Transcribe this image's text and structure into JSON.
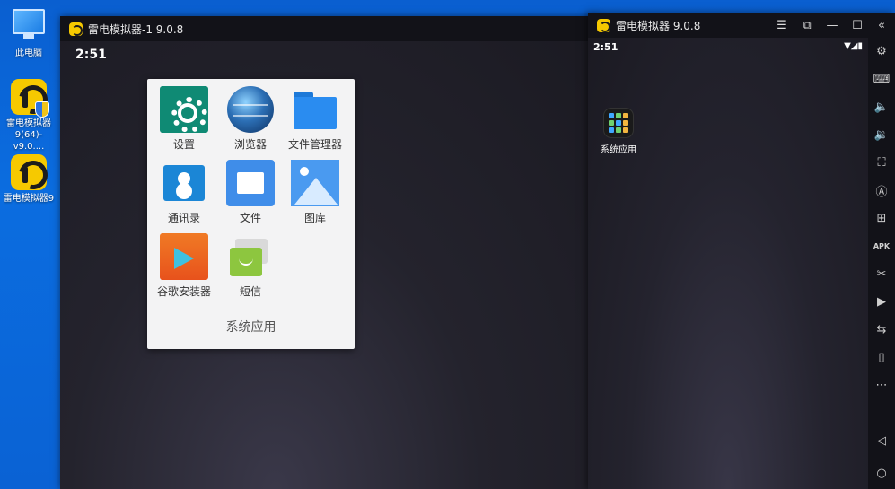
{
  "desktop": {
    "icons": [
      {
        "label": "此电脑"
      },
      {
        "label": "雷电模拟器9(64)-v9.0...."
      },
      {
        "label": "雷电模拟器9"
      }
    ]
  },
  "window1": {
    "title": "雷电模拟器-1 9.0.8",
    "clock": "2:51",
    "folder": {
      "title": "系统应用",
      "apps": [
        {
          "label": "设置",
          "icon": "settings-icon"
        },
        {
          "label": "浏览器",
          "icon": "browser-icon"
        },
        {
          "label": "文件管理器",
          "icon": "file-manager-icon"
        },
        {
          "label": "通讯录",
          "icon": "contacts-icon"
        },
        {
          "label": "文件",
          "icon": "files-icon"
        },
        {
          "label": "图库",
          "icon": "gallery-icon"
        },
        {
          "label": "谷歌安装器",
          "icon": "google-installer-icon"
        },
        {
          "label": "短信",
          "icon": "sms-icon"
        }
      ]
    }
  },
  "window2": {
    "title": "雷电模拟器 9.0.8",
    "clock": "2:51",
    "status_icons": "▼◢▮",
    "controls": {
      "menu": "☰",
      "restore": "⧉",
      "minimize": "—",
      "maximize": "☐",
      "close": "✕"
    },
    "home_app": {
      "label": "系统应用",
      "icon": "system-apps-folder-icon"
    },
    "sidebar": {
      "collapse": "«",
      "buttons": [
        {
          "icon": "settings-icon",
          "glyph": "⚙"
        },
        {
          "icon": "keyboard-icon",
          "glyph": "⌨"
        },
        {
          "icon": "volume-up-icon",
          "glyph": "🔈"
        },
        {
          "icon": "volume-down-icon",
          "glyph": "🔉"
        },
        {
          "icon": "screenshot-icon",
          "glyph": "⛶"
        },
        {
          "icon": "script-icon",
          "glyph": "Ⓐ"
        },
        {
          "icon": "multi-instance-icon",
          "glyph": "⊞"
        },
        {
          "icon": "apk-install-icon",
          "glyph": "APK"
        },
        {
          "icon": "scissors-icon",
          "glyph": "✂"
        },
        {
          "icon": "record-icon",
          "glyph": "▶"
        },
        {
          "icon": "sync-icon",
          "glyph": "⇆"
        },
        {
          "icon": "shake-icon",
          "glyph": "▯"
        },
        {
          "icon": "more-icon",
          "glyph": "⋯"
        }
      ],
      "nav": [
        {
          "icon": "back-icon",
          "glyph": "◁"
        },
        {
          "icon": "home-icon",
          "glyph": "○"
        }
      ]
    }
  }
}
